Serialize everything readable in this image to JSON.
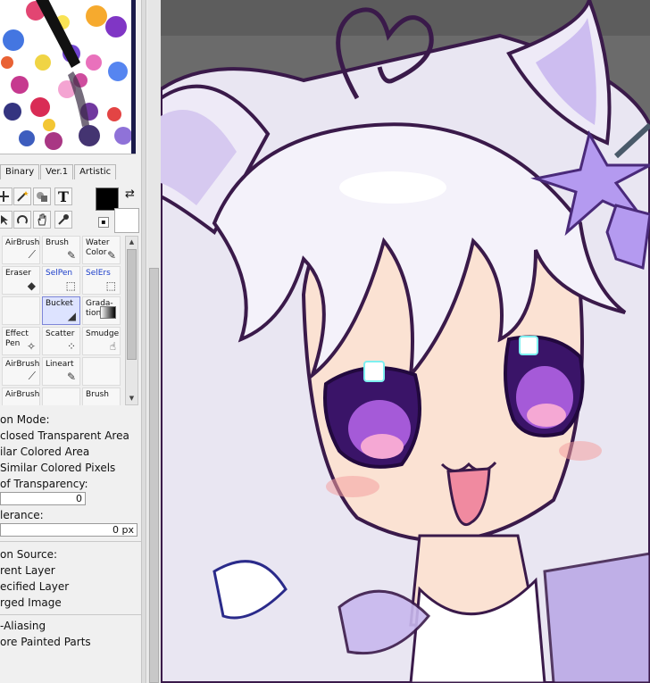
{
  "tool_tabs": [
    "Binary",
    "Ver.1",
    "Artistic"
  ],
  "quick_tools": {
    "row1": [
      "cross-icon",
      "magic-wand-icon",
      "shape-icon",
      "text-icon"
    ],
    "row2": [
      "arrow-icon",
      "rotate-icon",
      "hand-icon",
      "eyedropper-icon"
    ],
    "text_tool_glyph": "T"
  },
  "colors": {
    "foreground": "#000000",
    "background": "#ffffff",
    "selected_tool_bg": "#dde3ff",
    "link_blue": "#1a3cc9"
  },
  "brushes": [
    {
      "label": "AirBrush",
      "icon": "airbrush-icon"
    },
    {
      "label": "Brush",
      "icon": "brush-icon"
    },
    {
      "label": "Water Color",
      "icon": "watercolor-icon"
    },
    {
      "label": "Eraser",
      "icon": "eraser-icon"
    },
    {
      "label": "SelPen",
      "icon": "selpen-icon"
    },
    {
      "label": "SelErs",
      "icon": "selers-icon"
    },
    {
      "label": "",
      "icon": ""
    },
    {
      "label": "Bucket",
      "icon": "bucket-icon"
    },
    {
      "label": "Grada-tion",
      "icon": "gradation-icon"
    },
    {
      "label": "Effect Pen",
      "icon": "effect-pen-icon"
    },
    {
      "label": "Scatter",
      "icon": "scatter-icon"
    },
    {
      "label": "Smudge",
      "icon": "smudge-icon"
    },
    {
      "label": "AirBrush",
      "icon": "airbrush-icon"
    },
    {
      "label": "Lineart",
      "icon": "lineart-icon"
    },
    {
      "label": "",
      "icon": ""
    },
    {
      "label": "AirBrush",
      "icon": "airbrush-icon"
    },
    {
      "label": "",
      "icon": ""
    },
    {
      "label": "Brush",
      "icon": "brush-icon"
    }
  ],
  "selected_brush": "Bucket",
  "options": {
    "detection_mode_label": "on Mode:",
    "modes": [
      "closed Transparent Area",
      "ilar Colored Area",
      "Similar Colored Pixels"
    ],
    "transparency_label": "of Transparency:",
    "transparency_value": "0",
    "tolerance_label": "lerance:",
    "tolerance_value": "0 px",
    "source_label": "on Source:",
    "sources": [
      "rent Layer",
      "ecified Layer",
      "rged Image"
    ],
    "antialiasing": "-Aliasing",
    "ignore_painted": "ore Painted Parts"
  }
}
